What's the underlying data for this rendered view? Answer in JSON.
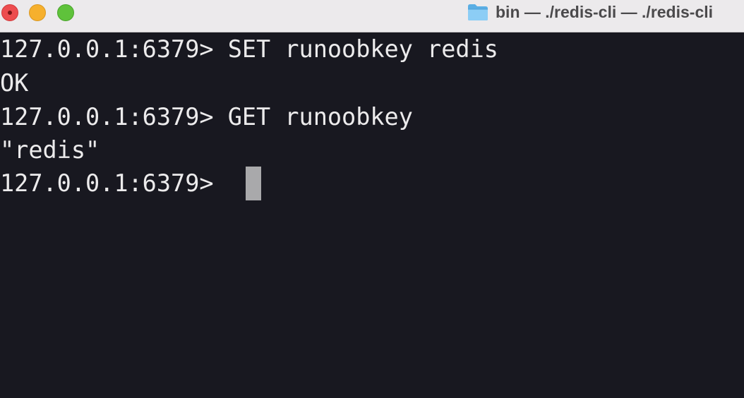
{
  "window": {
    "title": "bin — ./redis-cli — ./redis-cli",
    "folder_icon": "folder-icon",
    "traffic_lights": {
      "close_color": "#ed4d4f",
      "minimize_color": "#f6b02d",
      "zoom_color": "#5fc23b"
    }
  },
  "terminal": {
    "background": "#181820",
    "foreground": "#ecebec",
    "lines": [
      "127.0.0.1:6379> SET runoobkey redis",
      "OK",
      "127.0.0.1:6379> GET runoobkey",
      "\"redis\"",
      "127.0.0.1:6379> "
    ]
  }
}
